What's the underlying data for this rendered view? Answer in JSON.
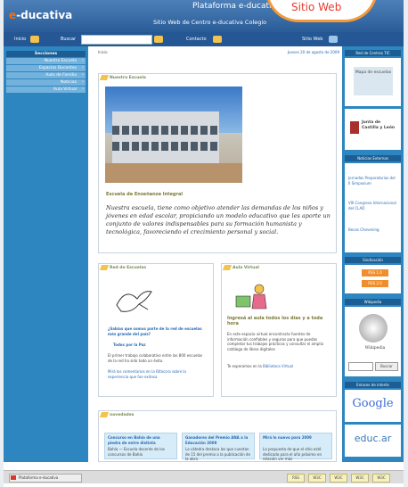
{
  "header": {
    "logo_prefix": "e",
    "logo_rest": "-ducativa",
    "platform": "Plataforma e-ducativa",
    "subtitle": "Sitio Web de Centro e-ducativa Colegio",
    "badge": "Sitio Web"
  },
  "toolbar": {
    "inicio": "Inicio",
    "buscar": "Buscar",
    "search_placeholder": "",
    "contacto": "Contacto",
    "sitio_web": "Sitio Web"
  },
  "left_menu": {
    "heading": "Secciones",
    "items": [
      "Nuestra Escuela",
      "Espacios Docentes",
      "Auto de Familia",
      "Noticias",
      "Aula Virtual"
    ]
  },
  "main": {
    "breadcrumb": "Inicio",
    "date": "Jueves 20 de agosto de 2009",
    "school_box": {
      "title": "Nuestra Escuela",
      "caption": "Escuela de Enseñanza Integral",
      "text": "Nuestra escuela, tiene como objetivo atender las demandas de los niños y jóvenes en edad escolar, propiciando un modelo educativo que les aporte un conjunto de valores indispensables para su formación humanista y tecnológica, favoreciendo el crecimiento personal y social."
    },
    "red_box": {
      "title": "Red de Escuelas",
      "question": "¿Sabías que somos parte de la red de escuelas más grande del país?",
      "link": "Todos por la Paz",
      "body": "El primer trabajo colaborativo entre las 800 escuelas de la red ha sido todo un éxito.",
      "more": "Mirá los comentarios en la Bitácora sobre la experiencia que fue exitosa"
    },
    "aula_box": {
      "title": "Aula Virtual",
      "heading": "Ingresá al aula todos los días y a toda hora",
      "body": "En este espacio virtual encontrarás fuentes de información confiables y seguras para que puedas completar tus trabajos prácticos y consultar el amplio catálogo de libros digitales",
      "link_pre": "Te esperamos en la",
      "link": "Biblioteca Virtual"
    },
    "news": {
      "title": "novedades",
      "items": [
        {
          "title": "Concurso en Bahía de una piedra de entre distinta",
          "body": "Bahía — Escuela docente de los concursos de Bahía"
        },
        {
          "title": "Ganadores del Premio ANA a la Educación 2009",
          "body": "La cátedra destaca los que cuentan de 15 del premio a la publicación de la obra"
        },
        {
          "title": "Mirá lo nuevo para 2009",
          "body": "La propuesta de que el sitio esté dedicado para el año próximo en relación ver más"
        }
      ]
    }
  },
  "right": {
    "red_title": "Red de Centros TIC",
    "mapa": "Mapa de escuelas",
    "jcyl": "Junta de Castilla y León",
    "enlaces_title": "Noticias Externas",
    "enlaces": [
      "Jornadas Preparatorias del II Simposium",
      "VIII Congreso Internacional del CLAD",
      "Becas Chevening"
    ],
    "sindicacion": "Sindicación",
    "rss": [
      "RSS 1.0",
      "RSS 2.0"
    ],
    "wikipedia_title": "Wikipedia",
    "wikipedia": "Wikipedia",
    "buscar_button": "Buscar",
    "buscador_title": "Enlaces de interés",
    "google": "Google",
    "educ": "educ.ar"
  },
  "footer": {
    "tab": "Plataforma e-ducativa",
    "badges": [
      "RSS",
      "W3C",
      "W3C",
      "W3C",
      "W3C"
    ]
  },
  "colors": {
    "header_blue": "#2a5c98",
    "side_blue": "#2e86c1",
    "accent_orange": "#f08d2c"
  }
}
